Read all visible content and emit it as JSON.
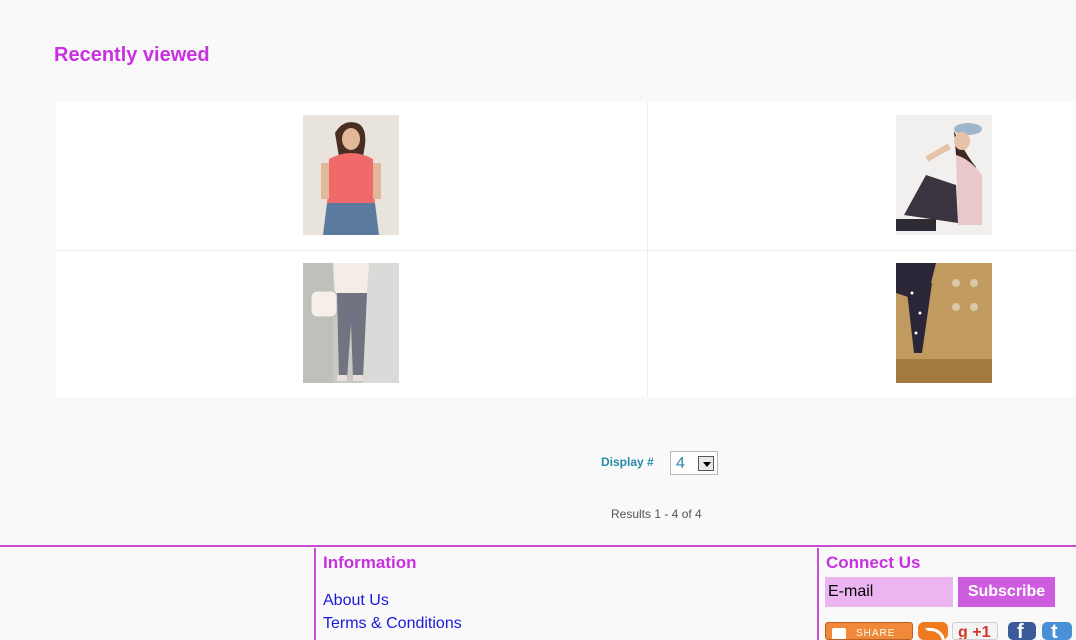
{
  "recently_viewed": {
    "title": "Recently viewed",
    "products": [
      {
        "image": "woman-in-coral-tshirt-photo"
      },
      {
        "image": "woman-in-cap-sitting-photo"
      },
      {
        "image": "woman-in-grey-trousers-photo"
      },
      {
        "image": "khaki-shorts-with-polka-dot-bow-photo"
      }
    ]
  },
  "pagination": {
    "display_label": "Display #",
    "display_value": "4",
    "results": "Results 1 - 4 of 4"
  },
  "footer": {
    "information": {
      "title": "Information",
      "links": [
        "About Us",
        "Terms & Conditions"
      ]
    },
    "connect": {
      "title": "Connect Us",
      "email_value": "E-mail",
      "subscribe_label": "Subscribe",
      "share_label": "SHARE",
      "gplus_label": "g +1",
      "facebook_label": "f",
      "twitter_label": "t"
    }
  },
  "colors": {
    "accent": "#c930e0",
    "link": "#1a1adb",
    "display_label": "#2a8aa8"
  }
}
